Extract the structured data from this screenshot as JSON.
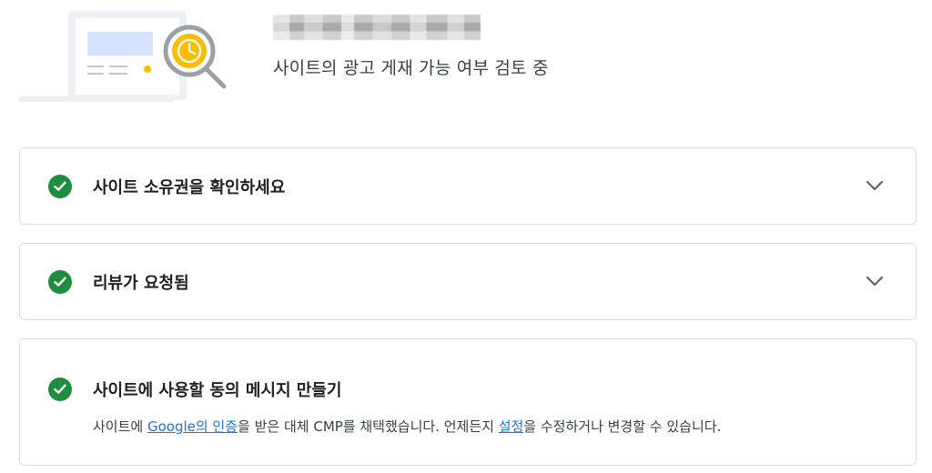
{
  "header": {
    "site_domain": "",
    "subtitle": "사이트의 광고 게재 가능 여부 검토 중"
  },
  "steps": [
    {
      "title": "사이트 소유권을 확인하세요",
      "status": "complete",
      "expandable": true
    },
    {
      "title": "리뷰가 요청됨",
      "status": "complete",
      "expandable": true
    },
    {
      "title": "사이트에 사용할 동의 메시지 만들기",
      "status": "complete",
      "description": {
        "prefix": "사이트에 ",
        "link1": "Google의 인증",
        "middle": "을 받은 대체 CMP를 채택했습니다. 언제든지 ",
        "link2": "설정",
        "suffix": "을 수정하거나 변경할 수 있습니다."
      }
    }
  ],
  "colors": {
    "check_green": "#1e8e3e",
    "link_blue": "#1a73e8",
    "border": "#dadce0",
    "illustration_yellow": "#fbbc04"
  }
}
